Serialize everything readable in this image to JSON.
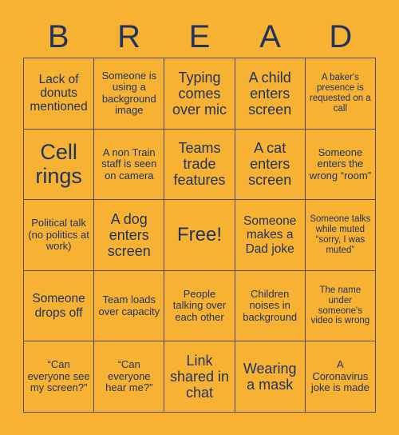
{
  "colors": {
    "background": "#f7b133",
    "text": "#20355e",
    "border": "#4e4e4e"
  },
  "header": {
    "letters": [
      "B",
      "R",
      "E",
      "A",
      "D"
    ]
  },
  "grid": {
    "rows": 5,
    "columns": 5,
    "cells": [
      {
        "text": "Lack of donuts mentioned",
        "size": "md"
      },
      {
        "text": "Someone is using a background image",
        "size": "sm"
      },
      {
        "text": "Typing comes over mic",
        "size": "lg"
      },
      {
        "text": "A child enters screen",
        "size": "lg"
      },
      {
        "text": "A baker's presence is requested on a call",
        "size": "xs"
      },
      {
        "text": "Cell rings",
        "size": "xxl"
      },
      {
        "text": "A non Train staff is seen on camera",
        "size": "sm"
      },
      {
        "text": "Teams trade features",
        "size": "lg"
      },
      {
        "text": "A cat enters screen",
        "size": "lg"
      },
      {
        "text": "Someone enters the wrong “room”",
        "size": "sm"
      },
      {
        "text": "Political talk (no politics at work)",
        "size": "sm"
      },
      {
        "text": "A dog enters screen",
        "size": "lg"
      },
      {
        "text": "Free!",
        "size": "xl"
      },
      {
        "text": "Someone makes a Dad joke",
        "size": "md"
      },
      {
        "text": "Someone talks while muted “sorry, I was muted”",
        "size": "xs"
      },
      {
        "text": "Someone drops off",
        "size": "md"
      },
      {
        "text": "Team loads over capacity",
        "size": "sm"
      },
      {
        "text": "People talking over each other",
        "size": "sm"
      },
      {
        "text": "Children noises in background",
        "size": "sm"
      },
      {
        "text": "The name under someone's video is wrong",
        "size": "xs"
      },
      {
        "text": "“Can everyone see my screen?”",
        "size": "sm"
      },
      {
        "text": "“Can everyone hear me?”",
        "size": "sm"
      },
      {
        "text": "Link shared in chat",
        "size": "lg"
      },
      {
        "text": "Wearing a mask",
        "size": "lg"
      },
      {
        "text": "A Coronavirus joke is made",
        "size": "sm"
      }
    ]
  }
}
